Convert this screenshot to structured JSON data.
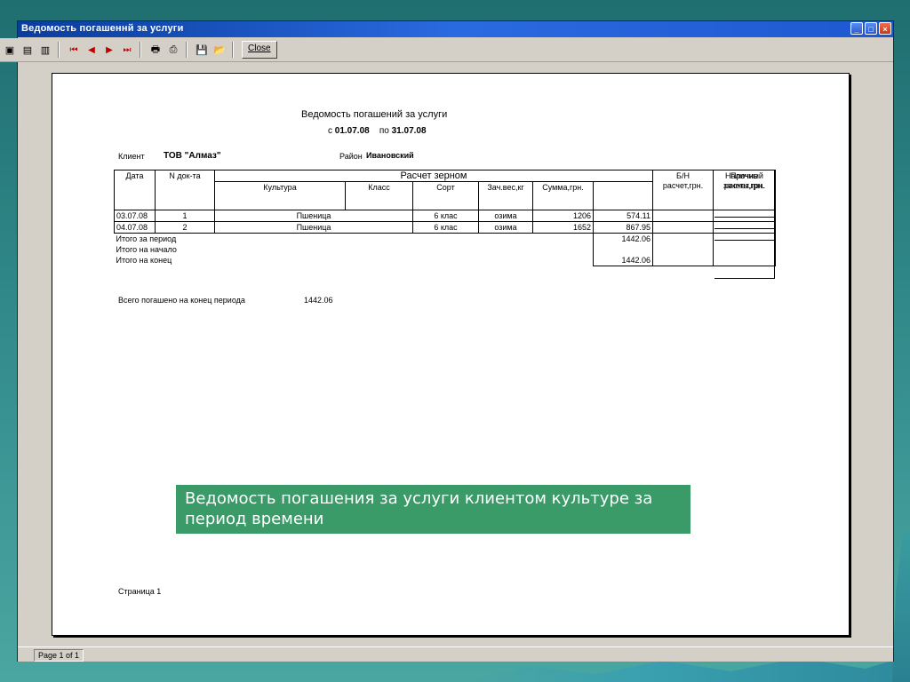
{
  "window": {
    "title": "Ведомость погашеннй за услуги",
    "buttons": {
      "minimize": "_",
      "maximize": "□",
      "close": "×"
    }
  },
  "toolbar": {
    "close_label": "Close"
  },
  "report": {
    "title": "Ведомость погашений за услуги",
    "period_from_label": "с",
    "period_from": "01.07.08",
    "period_to_label": "по",
    "period_to": "31.07.08",
    "client_label": "Клиент",
    "client_value": "ТОВ \"Алмаз\"",
    "region_label": "Район",
    "region_value": "Ивановский",
    "table": {
      "headers": {
        "date": "Дата",
        "doc_no": "N док-та",
        "grain_group": "Расчет зерном",
        "culture": "Культура",
        "class": "Класс",
        "sort": "Сорт",
        "weight": "Зач.вес,кг",
        "sum": "Сумма,грн.",
        "bn_1": "Б/Н",
        "bn_2": "расчет,грн.",
        "cash_1": "Наличный",
        "cash_2": "расчет,грн.",
        "other_1": "Прочие",
        "other_2": "зачеты,грн."
      },
      "rows": [
        {
          "date": "03.07.08",
          "doc": "1",
          "culture": "Пшеница",
          "class": "6 клас",
          "sort": "озима",
          "weight": "1206",
          "sum": "574.11"
        },
        {
          "date": "04.07.08",
          "doc": "2",
          "culture": "Пшеница",
          "class": "6 клас",
          "sort": "озима",
          "weight": "1652",
          "sum": "867.95"
        }
      ],
      "totals": {
        "period_label": "Итого за период",
        "period_value": "1442.06",
        "start_label": "Итого на начало",
        "start_value": "",
        "end_label": "Итого на конец",
        "end_value": "1442.06"
      }
    },
    "total_paid_label": "Всего погашено на конец периода",
    "total_paid_value": "1442.06",
    "page_label": "Страница 1"
  },
  "status": {
    "page": "Page 1 of 1"
  },
  "caption": {
    "text": "Ведомость погашения за услуги клиентом культуре за период времени"
  }
}
